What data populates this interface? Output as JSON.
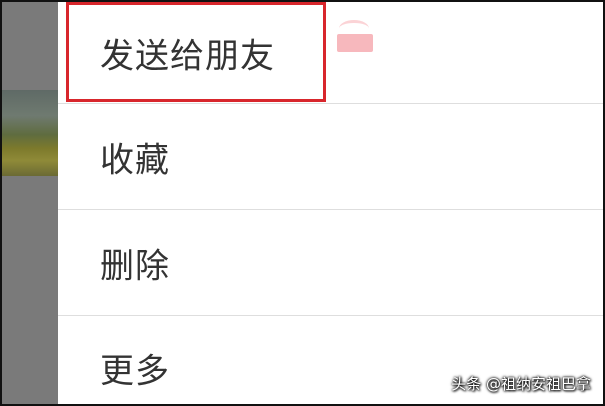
{
  "menu": {
    "items": [
      {
        "id": "send",
        "label": "发送给朋友"
      },
      {
        "id": "favorite",
        "label": "收藏"
      },
      {
        "id": "delete",
        "label": "删除"
      },
      {
        "id": "more",
        "label": "更多"
      }
    ]
  },
  "annotation": {
    "highlight_color": "#d8262c",
    "highlighted_item": "send"
  },
  "watermark": {
    "text": "头条 @祖纳安祖巴拿"
  },
  "colors": {
    "overlay": "#7a7a7a",
    "menu_background": "#ffffff",
    "label_text": "#333333",
    "divider": "#dedede"
  }
}
